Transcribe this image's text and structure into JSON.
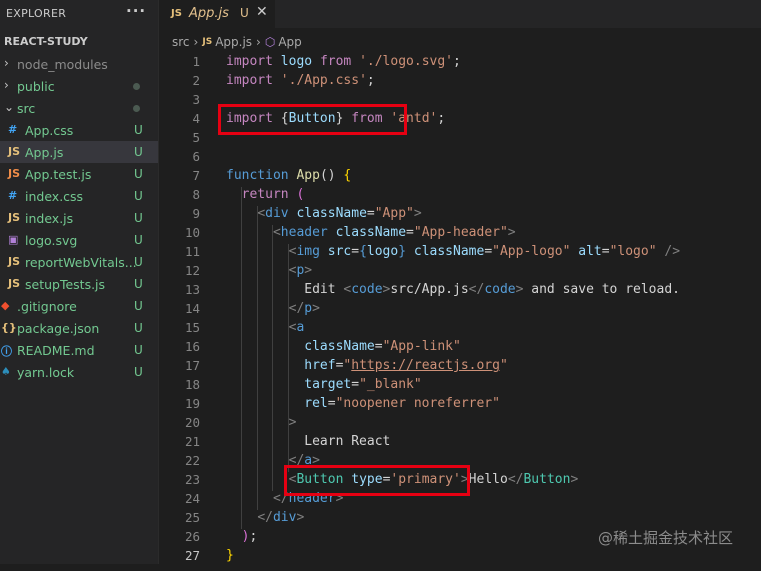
{
  "sidebar": {
    "title": "EXPLORER",
    "menu_glyph": "···",
    "project": "REACT-STUDY",
    "items": [
      {
        "label": "node_modules",
        "kind": "folder",
        "chevron": "›",
        "status": "",
        "color": "#8b8b8b"
      },
      {
        "label": "public",
        "kind": "folder",
        "chevron": "›",
        "status": "dot",
        "color": "#73c991"
      },
      {
        "label": "src",
        "kind": "folder",
        "chevron": "⌄",
        "status": "dot",
        "color": "#73c991"
      },
      {
        "label": "App.css",
        "kind": "file",
        "icon": "#",
        "iconColor": "#42a5f5",
        "status": "U",
        "color": "#73c991"
      },
      {
        "label": "App.js",
        "kind": "file",
        "icon": "JS",
        "iconColor": "#e5c07b",
        "status": "U",
        "color": "#73c991",
        "active": true
      },
      {
        "label": "App.test.js",
        "kind": "file",
        "icon": "JS",
        "iconColor": "#f08d49",
        "status": "U",
        "color": "#73c991"
      },
      {
        "label": "index.css",
        "kind": "file",
        "icon": "#",
        "iconColor": "#42a5f5",
        "status": "U",
        "color": "#73c991"
      },
      {
        "label": "index.js",
        "kind": "file",
        "icon": "JS",
        "iconColor": "#e5c07b",
        "status": "U",
        "color": "#73c991"
      },
      {
        "label": "logo.svg",
        "kind": "file",
        "icon": "▣",
        "iconColor": "#b180d7",
        "status": "U",
        "color": "#73c991"
      },
      {
        "label": "reportWebVitals...",
        "kind": "file",
        "icon": "JS",
        "iconColor": "#e5c07b",
        "status": "U",
        "color": "#73c991"
      },
      {
        "label": "setupTests.js",
        "kind": "file",
        "icon": "JS",
        "iconColor": "#e5c07b",
        "status": "U",
        "color": "#73c991"
      },
      {
        "label": ".gitignore",
        "kind": "root",
        "icon": "◆",
        "iconColor": "#f1502f",
        "status": "U",
        "color": "#73c991"
      },
      {
        "label": "package.json",
        "kind": "root",
        "icon": "{}",
        "iconColor": "#e5c07b",
        "status": "U",
        "color": "#73c991"
      },
      {
        "label": "README.md",
        "kind": "root",
        "icon": "ⓘ",
        "iconColor": "#42a5f5",
        "status": "U",
        "color": "#73c991"
      },
      {
        "label": "yarn.lock",
        "kind": "root",
        "icon": "♠",
        "iconColor": "#2c8ebb",
        "status": "U",
        "color": "#73c991"
      }
    ]
  },
  "tab": {
    "icon": "JS",
    "name": "App.js",
    "status": "U",
    "close": "✕"
  },
  "breadcrumb": {
    "folder": "src",
    "sep": "›",
    "file_icon": "JS",
    "file": "App.js",
    "symbol_icon": "⬡",
    "symbol": "App"
  },
  "editor": {
    "current_line": 27,
    "lines": [
      [
        [
          "import",
          "#c586c0"
        ],
        [
          " ",
          "#d4d4d4"
        ],
        [
          "logo",
          "#9cdcfe"
        ],
        [
          " ",
          "#d4d4d4"
        ],
        [
          "from",
          "#c586c0"
        ],
        [
          " ",
          "#d4d4d4"
        ],
        [
          "'./logo.svg'",
          "#ce9178"
        ],
        [
          ";",
          "#d4d4d4"
        ]
      ],
      [
        [
          "import",
          "#c586c0"
        ],
        [
          " ",
          "#d4d4d4"
        ],
        [
          "'./App.css'",
          "#ce9178"
        ],
        [
          ";",
          "#d4d4d4"
        ]
      ],
      [],
      [
        [
          "import",
          "#c586c0"
        ],
        [
          " ",
          "#d4d4d4"
        ],
        [
          "{",
          "#d4d4d4"
        ],
        [
          "Button",
          "#9cdcfe"
        ],
        [
          "}",
          "#d4d4d4"
        ],
        [
          " ",
          "#d4d4d4"
        ],
        [
          "from",
          "#c586c0"
        ],
        [
          " ",
          "#d4d4d4"
        ],
        [
          "'antd'",
          "#ce9178"
        ],
        [
          ";",
          "#d4d4d4"
        ]
      ],
      [],
      [],
      [
        [
          "function",
          "#569cd6"
        ],
        [
          " ",
          "#d4d4d4"
        ],
        [
          "App",
          "#dcdcaa"
        ],
        [
          "() ",
          "#d4d4d4"
        ],
        [
          "{",
          "#ffd700"
        ]
      ],
      [
        [
          "  return",
          "#c586c0"
        ],
        [
          " ",
          "#d4d4d4"
        ],
        [
          "(",
          "#da70d6"
        ]
      ],
      [
        [
          "    ",
          "#d4d4d4"
        ],
        [
          "<",
          "#808080"
        ],
        [
          "div",
          "#569cd6"
        ],
        [
          " ",
          "#d4d4d4"
        ],
        [
          "className",
          "#9cdcfe"
        ],
        [
          "=",
          "#d4d4d4"
        ],
        [
          "\"App\"",
          "#ce9178"
        ],
        [
          ">",
          "#808080"
        ]
      ],
      [
        [
          "      ",
          "#d4d4d4"
        ],
        [
          "<",
          "#808080"
        ],
        [
          "header",
          "#569cd6"
        ],
        [
          " ",
          "#d4d4d4"
        ],
        [
          "className",
          "#9cdcfe"
        ],
        [
          "=",
          "#d4d4d4"
        ],
        [
          "\"App-header\"",
          "#ce9178"
        ],
        [
          ">",
          "#808080"
        ]
      ],
      [
        [
          "        ",
          "#d4d4d4"
        ],
        [
          "<",
          "#808080"
        ],
        [
          "img",
          "#569cd6"
        ],
        [
          " ",
          "#d4d4d4"
        ],
        [
          "src",
          "#9cdcfe"
        ],
        [
          "=",
          "#d4d4d4"
        ],
        [
          "{",
          "#569cd6"
        ],
        [
          "logo",
          "#9cdcfe"
        ],
        [
          "}",
          "#569cd6"
        ],
        [
          " ",
          "#d4d4d4"
        ],
        [
          "className",
          "#9cdcfe"
        ],
        [
          "=",
          "#d4d4d4"
        ],
        [
          "\"App-logo\"",
          "#ce9178"
        ],
        [
          " ",
          "#d4d4d4"
        ],
        [
          "alt",
          "#9cdcfe"
        ],
        [
          "=",
          "#d4d4d4"
        ],
        [
          "\"logo\"",
          "#ce9178"
        ],
        [
          " ",
          "#d4d4d4"
        ],
        [
          "/>",
          "#808080"
        ]
      ],
      [
        [
          "        ",
          "#d4d4d4"
        ],
        [
          "<",
          "#808080"
        ],
        [
          "p",
          "#569cd6"
        ],
        [
          ">",
          "#808080"
        ]
      ],
      [
        [
          "          Edit ",
          "#d4d4d4"
        ],
        [
          "<",
          "#808080"
        ],
        [
          "code",
          "#569cd6"
        ],
        [
          ">",
          "#808080"
        ],
        [
          "src/App.js",
          "#d4d4d4"
        ],
        [
          "</",
          "#808080"
        ],
        [
          "code",
          "#569cd6"
        ],
        [
          ">",
          "#808080"
        ],
        [
          " and save to reload.",
          "#d4d4d4"
        ]
      ],
      [
        [
          "        ",
          "#d4d4d4"
        ],
        [
          "</",
          "#808080"
        ],
        [
          "p",
          "#569cd6"
        ],
        [
          ">",
          "#808080"
        ]
      ],
      [
        [
          "        ",
          "#d4d4d4"
        ],
        [
          "<",
          "#808080"
        ],
        [
          "a",
          "#569cd6"
        ]
      ],
      [
        [
          "          ",
          "#d4d4d4"
        ],
        [
          "className",
          "#9cdcfe"
        ],
        [
          "=",
          "#d4d4d4"
        ],
        [
          "\"App-link\"",
          "#ce9178"
        ]
      ],
      [
        [
          "          ",
          "#d4d4d4"
        ],
        [
          "href",
          "#9cdcfe"
        ],
        [
          "=",
          "#d4d4d4"
        ],
        [
          "\"",
          "#ce9178"
        ],
        [
          "https://reactjs.org",
          "#ce9178",
          "u"
        ],
        [
          "\"",
          "#ce9178"
        ]
      ],
      [
        [
          "          ",
          "#d4d4d4"
        ],
        [
          "target",
          "#9cdcfe"
        ],
        [
          "=",
          "#d4d4d4"
        ],
        [
          "\"_blank\"",
          "#ce9178"
        ]
      ],
      [
        [
          "          ",
          "#d4d4d4"
        ],
        [
          "rel",
          "#9cdcfe"
        ],
        [
          "=",
          "#d4d4d4"
        ],
        [
          "\"noopener noreferrer\"",
          "#ce9178"
        ]
      ],
      [
        [
          "        ",
          "#d4d4d4"
        ],
        [
          ">",
          "#808080"
        ]
      ],
      [
        [
          "          Learn React",
          "#d4d4d4"
        ]
      ],
      [
        [
          "        ",
          "#d4d4d4"
        ],
        [
          "</",
          "#808080"
        ],
        [
          "a",
          "#569cd6"
        ],
        [
          ">",
          "#808080"
        ]
      ],
      [
        [
          "        ",
          "#d4d4d4"
        ],
        [
          "<",
          "#808080"
        ],
        [
          "Button",
          "#4ec9b0"
        ],
        [
          " ",
          "#d4d4d4"
        ],
        [
          "type",
          "#9cdcfe"
        ],
        [
          "=",
          "#d4d4d4"
        ],
        [
          "'primary'",
          "#ce9178"
        ],
        [
          ">",
          "#808080"
        ],
        [
          "Hello",
          "#d4d4d4"
        ],
        [
          "</",
          "#808080"
        ],
        [
          "Button",
          "#4ec9b0"
        ],
        [
          ">",
          "#808080"
        ]
      ],
      [
        [
          "      ",
          "#d4d4d4"
        ],
        [
          "</",
          "#808080"
        ],
        [
          "header",
          "#569cd6"
        ],
        [
          ">",
          "#808080"
        ]
      ],
      [
        [
          "    ",
          "#d4d4d4"
        ],
        [
          "</",
          "#808080"
        ],
        [
          "div",
          "#569cd6"
        ],
        [
          ">",
          "#808080"
        ]
      ],
      [
        [
          "  ",
          "#d4d4d4"
        ],
        [
          ")",
          "#da70d6"
        ],
        [
          ";",
          "#d4d4d4"
        ]
      ],
      [
        [
          "}",
          "#ffd700"
        ]
      ]
    ]
  },
  "highlights": [
    {
      "name": "import-button-highlight",
      "line": 4
    },
    {
      "name": "button-element-highlight",
      "line": 23
    }
  ],
  "watermark": "@稀土掘金技术社区"
}
